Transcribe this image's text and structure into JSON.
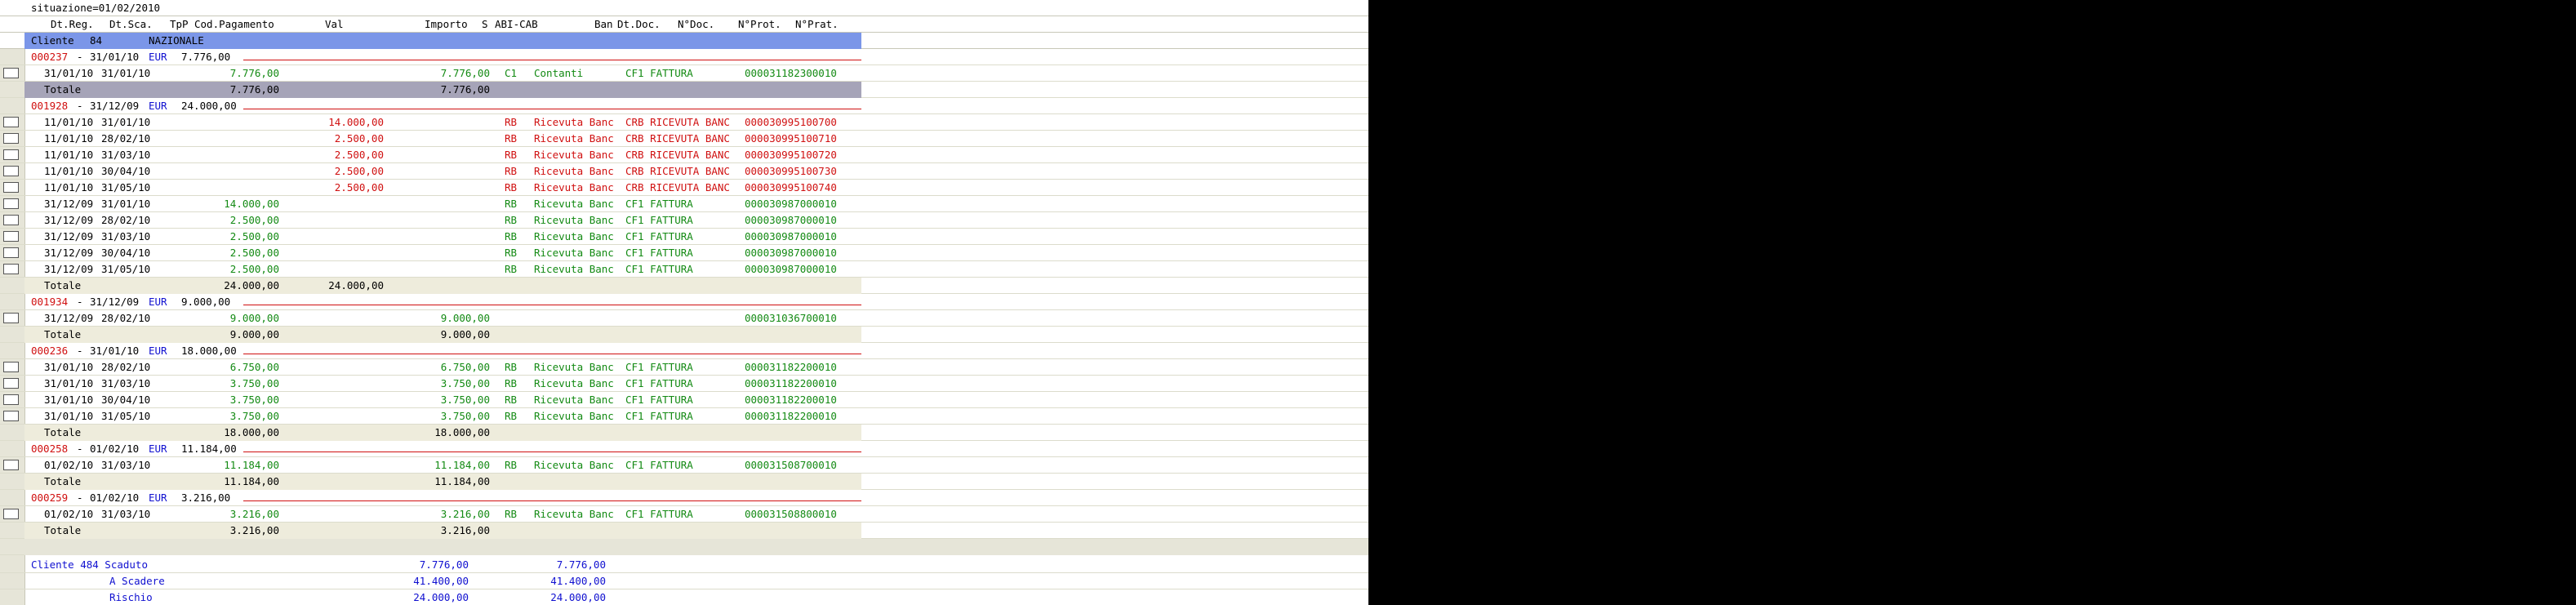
{
  "corner": "?",
  "situazione": "situazione=01/02/2010",
  "columns": {
    "dtreg": "Dt.Reg.",
    "dtsca": "Dt.Sca.",
    "tpp": "TpP",
    "codpag": "Cod.Pagamento",
    "val": "Val",
    "importo": "Importo",
    "s": "S",
    "abicab": "ABI-CAB",
    "ban": "Ban",
    "dtdoc": "Dt.Doc.",
    "ndoc": "N°Doc.",
    "nprot": "N°Prot.",
    "nprat": "N°Prat."
  },
  "cliente": {
    "label": "Cliente",
    "num": "84",
    "tipo": "NAZIONALE"
  },
  "groups": [
    {
      "header": {
        "code": "000237",
        "date": "31/01/10",
        "cur": "EUR",
        "amount": "7.776,00"
      },
      "rows": [
        {
          "dtreg": "31/01/10",
          "dtsca": "31/01/10",
          "amount": "7.776,00",
          "val": "",
          "importo": "7.776,00",
          "tpp": "C1",
          "pag": "Contanti",
          "doc": "CF1 FATTURA",
          "prot": "000031182300010",
          "color": "green"
        }
      ],
      "total": {
        "label": "Totale",
        "amount": "7.776,00",
        "val": "",
        "importo": "7.776,00",
        "selected": true
      }
    },
    {
      "header": {
        "code": "001928",
        "date": "31/12/09",
        "cur": "EUR",
        "amount": "24.000,00"
      },
      "rows": [
        {
          "dtreg": "11/01/10",
          "dtsca": "31/01/10",
          "amount": "",
          "val": "14.000,00",
          "importo": "",
          "tpp": "RB",
          "pag": "Ricevuta Banc",
          "doc": "CRB RICEVUTA BANC",
          "prot": "000030995100700",
          "color": "red"
        },
        {
          "dtreg": "11/01/10",
          "dtsca": "28/02/10",
          "amount": "",
          "val": "2.500,00",
          "importo": "",
          "tpp": "RB",
          "pag": "Ricevuta Banc",
          "doc": "CRB RICEVUTA BANC",
          "prot": "000030995100710",
          "color": "red"
        },
        {
          "dtreg": "11/01/10",
          "dtsca": "31/03/10",
          "amount": "",
          "val": "2.500,00",
          "importo": "",
          "tpp": "RB",
          "pag": "Ricevuta Banc",
          "doc": "CRB RICEVUTA BANC",
          "prot": "000030995100720",
          "color": "red"
        },
        {
          "dtreg": "11/01/10",
          "dtsca": "30/04/10",
          "amount": "",
          "val": "2.500,00",
          "importo": "",
          "tpp": "RB",
          "pag": "Ricevuta Banc",
          "doc": "CRB RICEVUTA BANC",
          "prot": "000030995100730",
          "color": "red"
        },
        {
          "dtreg": "11/01/10",
          "dtsca": "31/05/10",
          "amount": "",
          "val": "2.500,00",
          "importo": "",
          "tpp": "RB",
          "pag": "Ricevuta Banc",
          "doc": "CRB RICEVUTA BANC",
          "prot": "000030995100740",
          "color": "red"
        },
        {
          "dtreg": "31/12/09",
          "dtsca": "31/01/10",
          "amount": "14.000,00",
          "val": "",
          "importo": "",
          "tpp": "RB",
          "pag": "Ricevuta Banc",
          "doc": "CF1 FATTURA",
          "prot": "000030987000010",
          "color": "green"
        },
        {
          "dtreg": "31/12/09",
          "dtsca": "28/02/10",
          "amount": "2.500,00",
          "val": "",
          "importo": "",
          "tpp": "RB",
          "pag": "Ricevuta Banc",
          "doc": "CF1 FATTURA",
          "prot": "000030987000010",
          "color": "green"
        },
        {
          "dtreg": "31/12/09",
          "dtsca": "31/03/10",
          "amount": "2.500,00",
          "val": "",
          "importo": "",
          "tpp": "RB",
          "pag": "Ricevuta Banc",
          "doc": "CF1 FATTURA",
          "prot": "000030987000010",
          "color": "green"
        },
        {
          "dtreg": "31/12/09",
          "dtsca": "30/04/10",
          "amount": "2.500,00",
          "val": "",
          "importo": "",
          "tpp": "RB",
          "pag": "Ricevuta Banc",
          "doc": "CF1 FATTURA",
          "prot": "000030987000010",
          "color": "green"
        },
        {
          "dtreg": "31/12/09",
          "dtsca": "31/05/10",
          "amount": "2.500,00",
          "val": "",
          "importo": "",
          "tpp": "RB",
          "pag": "Ricevuta Banc",
          "doc": "CF1 FATTURA",
          "prot": "000030987000010",
          "color": "green"
        }
      ],
      "total": {
        "label": "Totale",
        "amount": "24.000,00",
        "val": "24.000,00",
        "importo": "",
        "selected": false
      }
    },
    {
      "header": {
        "code": "001934",
        "date": "31/12/09",
        "cur": "EUR",
        "amount": "9.000,00"
      },
      "rows": [
        {
          "dtreg": "31/12/09",
          "dtsca": "28/02/10",
          "amount": "9.000,00",
          "val": "",
          "importo": "9.000,00",
          "tpp": "",
          "pag": "",
          "doc": "",
          "prot": "000031036700010",
          "color": "green"
        }
      ],
      "total": {
        "label": "Totale",
        "amount": "9.000,00",
        "val": "",
        "importo": "9.000,00",
        "selected": false
      }
    },
    {
      "header": {
        "code": "000236",
        "date": "31/01/10",
        "cur": "EUR",
        "amount": "18.000,00"
      },
      "rows": [
        {
          "dtreg": "31/01/10",
          "dtsca": "28/02/10",
          "amount": "6.750,00",
          "val": "",
          "importo": "6.750,00",
          "tpp": "RB",
          "pag": "Ricevuta Banc",
          "doc": "CF1 FATTURA",
          "prot": "000031182200010",
          "color": "green"
        },
        {
          "dtreg": "31/01/10",
          "dtsca": "31/03/10",
          "amount": "3.750,00",
          "val": "",
          "importo": "3.750,00",
          "tpp": "RB",
          "pag": "Ricevuta Banc",
          "doc": "CF1 FATTURA",
          "prot": "000031182200010",
          "color": "green"
        },
        {
          "dtreg": "31/01/10",
          "dtsca": "30/04/10",
          "amount": "3.750,00",
          "val": "",
          "importo": "3.750,00",
          "tpp": "RB",
          "pag": "Ricevuta Banc",
          "doc": "CF1 FATTURA",
          "prot": "000031182200010",
          "color": "green"
        },
        {
          "dtreg": "31/01/10",
          "dtsca": "31/05/10",
          "amount": "3.750,00",
          "val": "",
          "importo": "3.750,00",
          "tpp": "RB",
          "pag": "Ricevuta Banc",
          "doc": "CF1 FATTURA",
          "prot": "000031182200010",
          "color": "green"
        }
      ],
      "total": {
        "label": "Totale",
        "amount": "18.000,00",
        "val": "",
        "importo": "18.000,00",
        "selected": false
      }
    },
    {
      "header": {
        "code": "000258",
        "date": "01/02/10",
        "cur": "EUR",
        "amount": "11.184,00"
      },
      "rows": [
        {
          "dtreg": "01/02/10",
          "dtsca": "31/03/10",
          "amount": "11.184,00",
          "val": "",
          "importo": "11.184,00",
          "tpp": "RB",
          "pag": "Ricevuta Banc",
          "doc": "CF1 FATTURA",
          "prot": "000031508700010",
          "color": "green"
        }
      ],
      "total": {
        "label": "Totale",
        "amount": "11.184,00",
        "val": "",
        "importo": "11.184,00",
        "selected": false
      }
    },
    {
      "header": {
        "code": "000259",
        "date": "01/02/10",
        "cur": "EUR",
        "amount": "3.216,00"
      },
      "rows": [
        {
          "dtreg": "01/02/10",
          "dtsca": "31/03/10",
          "amount": "3.216,00",
          "val": "",
          "importo": "3.216,00",
          "tpp": "RB",
          "pag": "Ricevuta Banc",
          "doc": "CF1 FATTURA",
          "prot": "000031508800010",
          "color": "green"
        }
      ],
      "total": {
        "label": "Totale",
        "amount": "3.216,00",
        "val": "",
        "importo": "3.216,00",
        "selected": false
      }
    }
  ],
  "summary": [
    {
      "label": "Cliente 484 Scaduto",
      "a": "7.776,00",
      "b": "7.776,00"
    },
    {
      "label": "A Scadere",
      "a": "41.400,00",
      "b": "41.400,00"
    },
    {
      "label": "Rischio",
      "a": "24.000,00",
      "b": "24.000,00"
    }
  ],
  "colors": {
    "red": "#d01010",
    "blue": "#1010d0",
    "green": "#138a13",
    "header_band": "#7b96e8",
    "selected_total": "#a6a4b8",
    "total_bg": "#eeecdc",
    "gutter": "#e6e5d8",
    "corner": "#ecec7a"
  }
}
